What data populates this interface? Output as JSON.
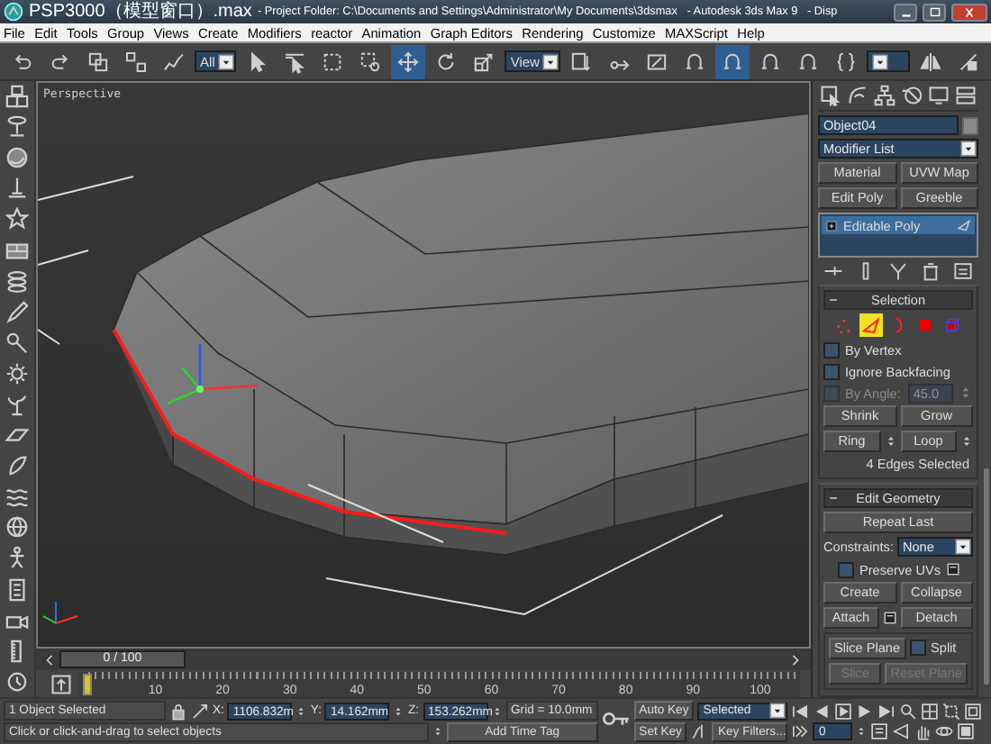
{
  "window": {
    "title_file": "PSP3000（模型窗口）.max",
    "title_rest": "- Project Folder: C:\\Documents and Settings\\Administrator\\My Documents\\3dsmax   - Autodesk 3ds Max 9   - Disp"
  },
  "menu": [
    "File",
    "Edit",
    "Tools",
    "Group",
    "Views",
    "Create",
    "Modifiers",
    "reactor",
    "Animation",
    "Graph Editors",
    "Rendering",
    "Customize",
    "MAXScript",
    "Help"
  ],
  "toolbar": [
    {
      "kind": "undo",
      "active": false
    },
    {
      "kind": "redo",
      "active": false
    },
    {
      "kind": "link",
      "active": false
    },
    {
      "kind": "unlink",
      "active": false
    },
    {
      "kind": "bind",
      "active": false
    },
    {
      "kind": "dropdown",
      "value": "All"
    },
    {
      "kind": "select",
      "active": false
    },
    {
      "kind": "select_by_name",
      "active": false
    },
    {
      "kind": "region",
      "active": false
    },
    {
      "kind": "crossing",
      "active": false
    },
    {
      "kind": "move",
      "active": true
    },
    {
      "kind": "rotate",
      "active": false
    },
    {
      "kind": "scale",
      "active": false
    },
    {
      "kind": "dropdown",
      "value": "View"
    },
    {
      "kind": "pivot",
      "active": false
    },
    {
      "kind": "manipulate",
      "active": false
    },
    {
      "kind": "keyboard",
      "active": false
    },
    {
      "kind": "snap",
      "active": false
    },
    {
      "kind": "snap",
      "active": true
    },
    {
      "kind": "snap",
      "active": false
    },
    {
      "kind": "snap",
      "active": false
    },
    {
      "kind": "named_sets",
      "active": false
    },
    {
      "kind": "dropdown"
    },
    {
      "kind": "mirror",
      "active": false
    },
    {
      "kind": "align",
      "active": false
    }
  ],
  "viewport": {
    "label": "Perspective"
  },
  "command_panel": {
    "object_name": "Object04",
    "modifier_list": "Modifier List",
    "modifier_buttons": [
      "Material",
      "UVW Map",
      "Edit Poly",
      "Greeble"
    ],
    "stack": [
      {
        "label": "Editable Poly",
        "selected": true
      }
    ],
    "selection": {
      "title": "Selection",
      "subobjects": [
        {
          "kind": "vertex",
          "selected": false
        },
        {
          "kind": "edge",
          "selected": true
        },
        {
          "kind": "border",
          "selected": false
        },
        {
          "kind": "polygon",
          "selected": false
        },
        {
          "kind": "element",
          "selected": false
        }
      ],
      "options": [
        {
          "label": "By Vertex",
          "checked": false,
          "disabled": false
        },
        {
          "label": "Ignore Backfacing",
          "checked": false,
          "disabled": false
        },
        {
          "label": "By Angle:",
          "checked": false,
          "disabled": true,
          "value": "45.0"
        }
      ],
      "buttons": [
        {
          "label": "Shrink",
          "spinner": false
        },
        {
          "label": "Grow",
          "spinner": false
        },
        {
          "label": "Ring",
          "spinner": true
        },
        {
          "label": "Loop",
          "spinner": true
        }
      ],
      "info": "4 Edges Selected"
    },
    "edit_geometry": {
      "title": "Edit Geometry",
      "repeat_last": "Repeat Last",
      "constraints_label": "Constraints:",
      "constraints": "None",
      "preserve_uvs": {
        "label": "Preserve UVs",
        "checked": false
      },
      "buttons": [
        {
          "label": "Create",
          "settings": false
        },
        {
          "label": "Collapse",
          "settings": false
        },
        {
          "label": "Attach",
          "settings": true
        },
        {
          "label": "Detach",
          "settings": false
        }
      ],
      "slice_plane": "Slice Plane",
      "split": {
        "label": "Split",
        "checked": false
      },
      "slice": {
        "label": "Slice",
        "disabled": true
      },
      "reset_plane": {
        "label": "Reset Plane",
        "disabled": true
      }
    }
  },
  "time_slider": {
    "label": "0 / 100",
    "level": 0
  },
  "ruler": [
    "10",
    "20",
    "30",
    "40",
    "50",
    "60",
    "70",
    "80",
    "90",
    "100"
  ],
  "status": {
    "selection": "1 Object Selected",
    "prompt": "Click or click-and-drag to select objects",
    "coords": [
      {
        "axis": "X:",
        "value": "1106.832m"
      },
      {
        "axis": "Y:",
        "value": "14.162mm"
      },
      {
        "axis": "Z:",
        "value": "153.262mm"
      }
    ],
    "grid": "Grid = 10.0mm",
    "add_time_tag": "Add Time Tag",
    "auto_key": "Auto Key",
    "key_mode": "Selected",
    "set_key": "Set Key",
    "key_filters": "Key Filters...",
    "frame": "0"
  }
}
